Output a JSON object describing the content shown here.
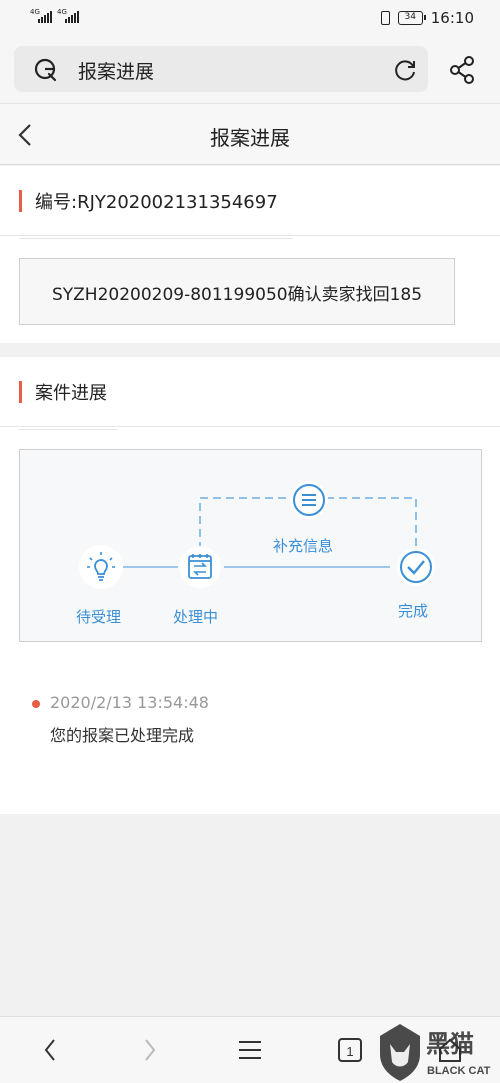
{
  "status_bar": {
    "signal1": "4G",
    "signal2": "4G",
    "battery": "34",
    "time": "16:10"
  },
  "browser": {
    "url_text": "报案进展"
  },
  "header": {
    "title": "报案进展"
  },
  "case_card": {
    "number_label": "编号:RJY202002131354697",
    "description": "SYZH20200209-801199050确认卖家找回185"
  },
  "progress_card": {
    "section_title": "案件进展",
    "steps": [
      {
        "label": "待受理",
        "icon": "lightbulb-icon"
      },
      {
        "label": "处理中",
        "icon": "calendar-swap-icon"
      },
      {
        "label": "补充信息",
        "icon": "list-icon"
      },
      {
        "label": "完成",
        "icon": "check-icon"
      }
    ],
    "accent_color": "#3a8fd6",
    "timeline": [
      {
        "time": "2020/2/13 13:54:48",
        "message": "您的报案已处理完成"
      }
    ]
  },
  "watermark": {
    "text_cn": "黑猫",
    "text_en": "BLACK CAT"
  }
}
